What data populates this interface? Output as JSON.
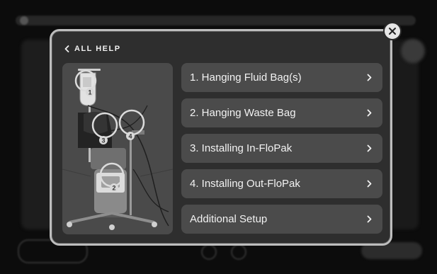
{
  "help": {
    "back_label": "ALL HELP",
    "items": [
      {
        "label": "1. Hanging Fluid Bag(s)"
      },
      {
        "label": "2. Hanging Waste Bag"
      },
      {
        "label": "3. Installing In-FloPak"
      },
      {
        "label": "4. Installing Out-FloPak"
      },
      {
        "label": "Additional Setup"
      }
    ],
    "diagram_callouts": [
      "1",
      "2",
      "3",
      "4"
    ]
  },
  "icons": {
    "close": "close-icon",
    "back": "chevron-left-icon",
    "item_chevron": "chevron-right-icon"
  },
  "colors": {
    "modal_bg": "#2e2e2e",
    "item_bg": "#4b4b4b",
    "border": "#bdbdbd"
  }
}
